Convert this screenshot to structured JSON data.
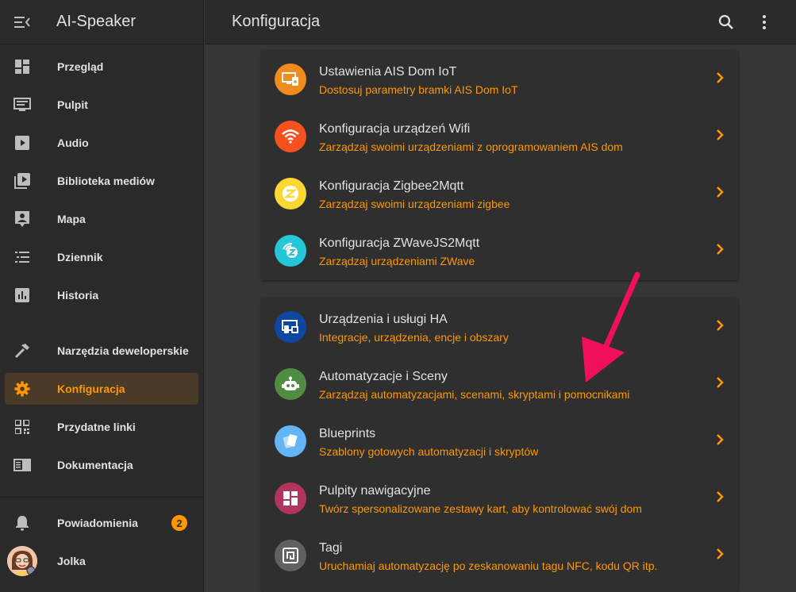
{
  "app": {
    "title": "AI-Speaker"
  },
  "header": {
    "title": "Konfiguracja"
  },
  "sidebar": {
    "items": [
      {
        "label": "Przegląd",
        "icon": "dashboard-icon"
      },
      {
        "label": "Pulpit",
        "icon": "monitor-icon"
      },
      {
        "label": "Audio",
        "icon": "play-icon"
      },
      {
        "label": "Biblioteka mediów",
        "icon": "media-library-icon"
      },
      {
        "label": "Mapa",
        "icon": "map-person-icon"
      },
      {
        "label": "Dziennik",
        "icon": "list-icon"
      },
      {
        "label": "Historia",
        "icon": "chart-icon"
      },
      {
        "label": "Narzędzia deweloperskie",
        "icon": "hammer-icon"
      },
      {
        "label": "Konfiguracja",
        "icon": "gear-icon",
        "active": true
      },
      {
        "label": "Przydatne linki",
        "icon": "qr-code-icon"
      },
      {
        "label": "Dokumentacja",
        "icon": "book-icon"
      }
    ],
    "notifications": {
      "label": "Powiadomienia",
      "count": "2"
    },
    "user": {
      "name": "Jolka"
    }
  },
  "cards": [
    [
      {
        "title": "Ustawienia AIS Dom IoT",
        "subtitle": "Dostosuj parametry bramki AIS Dom IoT",
        "color": "#f08c1e",
        "icon": "iot-device-icon"
      },
      {
        "title": "Konfiguracja urządzeń Wifi",
        "subtitle": "Zarządzaj swoimi urządzeniami z oprogramowaniem AIS dom",
        "color": "#f4511e",
        "icon": "wifi-icon"
      },
      {
        "title": "Konfiguracja Zigbee2Mqtt",
        "subtitle": "Zarządzaj swoimi urządzeniami zigbee",
        "color": "#fdd835",
        "icon": "zigbee-icon"
      },
      {
        "title": "Konfiguracja ZWaveJS2Mqtt",
        "subtitle": "Zarządzaj urządzeniami ZWave",
        "color": "#26c6da",
        "icon": "zwave-icon"
      }
    ],
    [
      {
        "title": "Urządzenia i usługi HA",
        "subtitle": "Integracje, urządzenia, encje i obszary",
        "color": "#0d47a1",
        "icon": "devices-icon"
      },
      {
        "title": "Automatyzacje i Sceny",
        "subtitle": "Zarządzaj automatyzacjami, scenami, skryptami i pomocnikami",
        "color": "#518c43",
        "icon": "robot-icon"
      },
      {
        "title": "Blueprints",
        "subtitle": "Szablony gotowych automatyzacji i skryptów",
        "color": "#64b5f6",
        "icon": "blueprint-icon"
      },
      {
        "title": "Pulpity nawigacyjne",
        "subtitle": "Twórz spersonalizowane zestawy kart, aby kontrolować swój dom",
        "color": "#b1345c",
        "icon": "dashboards-icon"
      },
      {
        "title": "Tagi",
        "subtitle": "Uruchamiaj automatyzację po zeskanowaniu tagu NFC, kodu QR itp.",
        "color": "#616161",
        "icon": "nfc-tag-icon"
      }
    ]
  ],
  "colors": {
    "accent": "#ff9800",
    "annotation_arrow": "#f0105a"
  }
}
